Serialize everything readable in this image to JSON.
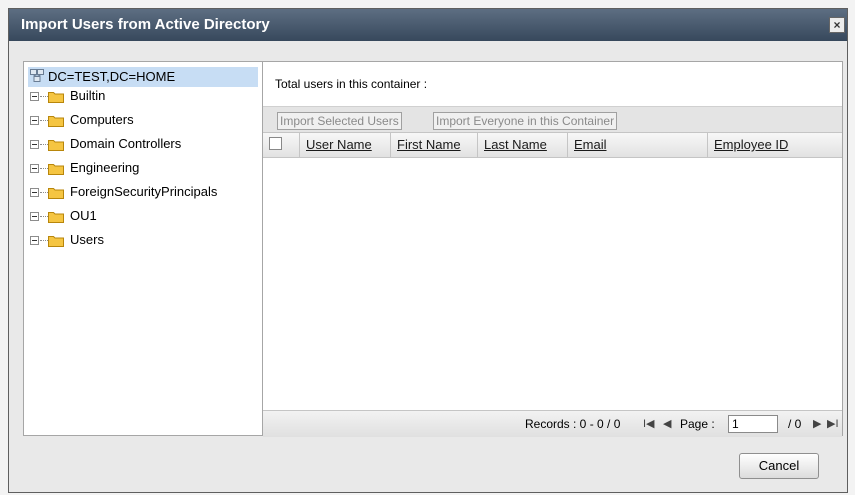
{
  "dialog": {
    "title": "Import Users from Active Directory",
    "close_glyph": "×",
    "cancel_label": "Cancel"
  },
  "tree": {
    "root_label": "DC=TEST,DC=HOME",
    "root_icon": "network-domain-icon",
    "items": [
      {
        "label": "Builtin",
        "icon": "folder-icon"
      },
      {
        "label": "Computers",
        "icon": "folder-icon"
      },
      {
        "label": "Domain Controllers",
        "icon": "folder-icon"
      },
      {
        "label": "Engineering",
        "icon": "folder-icon"
      },
      {
        "label": "ForeignSecurityPrincipals",
        "icon": "folder-icon"
      },
      {
        "label": "OU1",
        "icon": "folder-icon"
      },
      {
        "label": "Users",
        "icon": "folder-icon"
      }
    ]
  },
  "grid": {
    "total_label": "Total users in this container :",
    "toolbar": {
      "import_selected": "Import Selected Users",
      "import_everyone": "Import Everyone in this Container"
    },
    "columns": [
      "User Name",
      "First Name",
      "Last Name",
      "Email",
      "Employee ID"
    ],
    "rows": [],
    "footer": {
      "records": "Records : 0 - 0 / 0",
      "page_label": "Page :",
      "page_value": "1",
      "page_total": "/ 0",
      "first_glyph": "I◀",
      "prev_glyph": "◀",
      "next_glyph": "▶",
      "last_glyph": "▶I"
    }
  },
  "colors": {
    "title_bar": "#37485c",
    "selected_node": "#c7ddf4",
    "folder": "#f5c542"
  }
}
